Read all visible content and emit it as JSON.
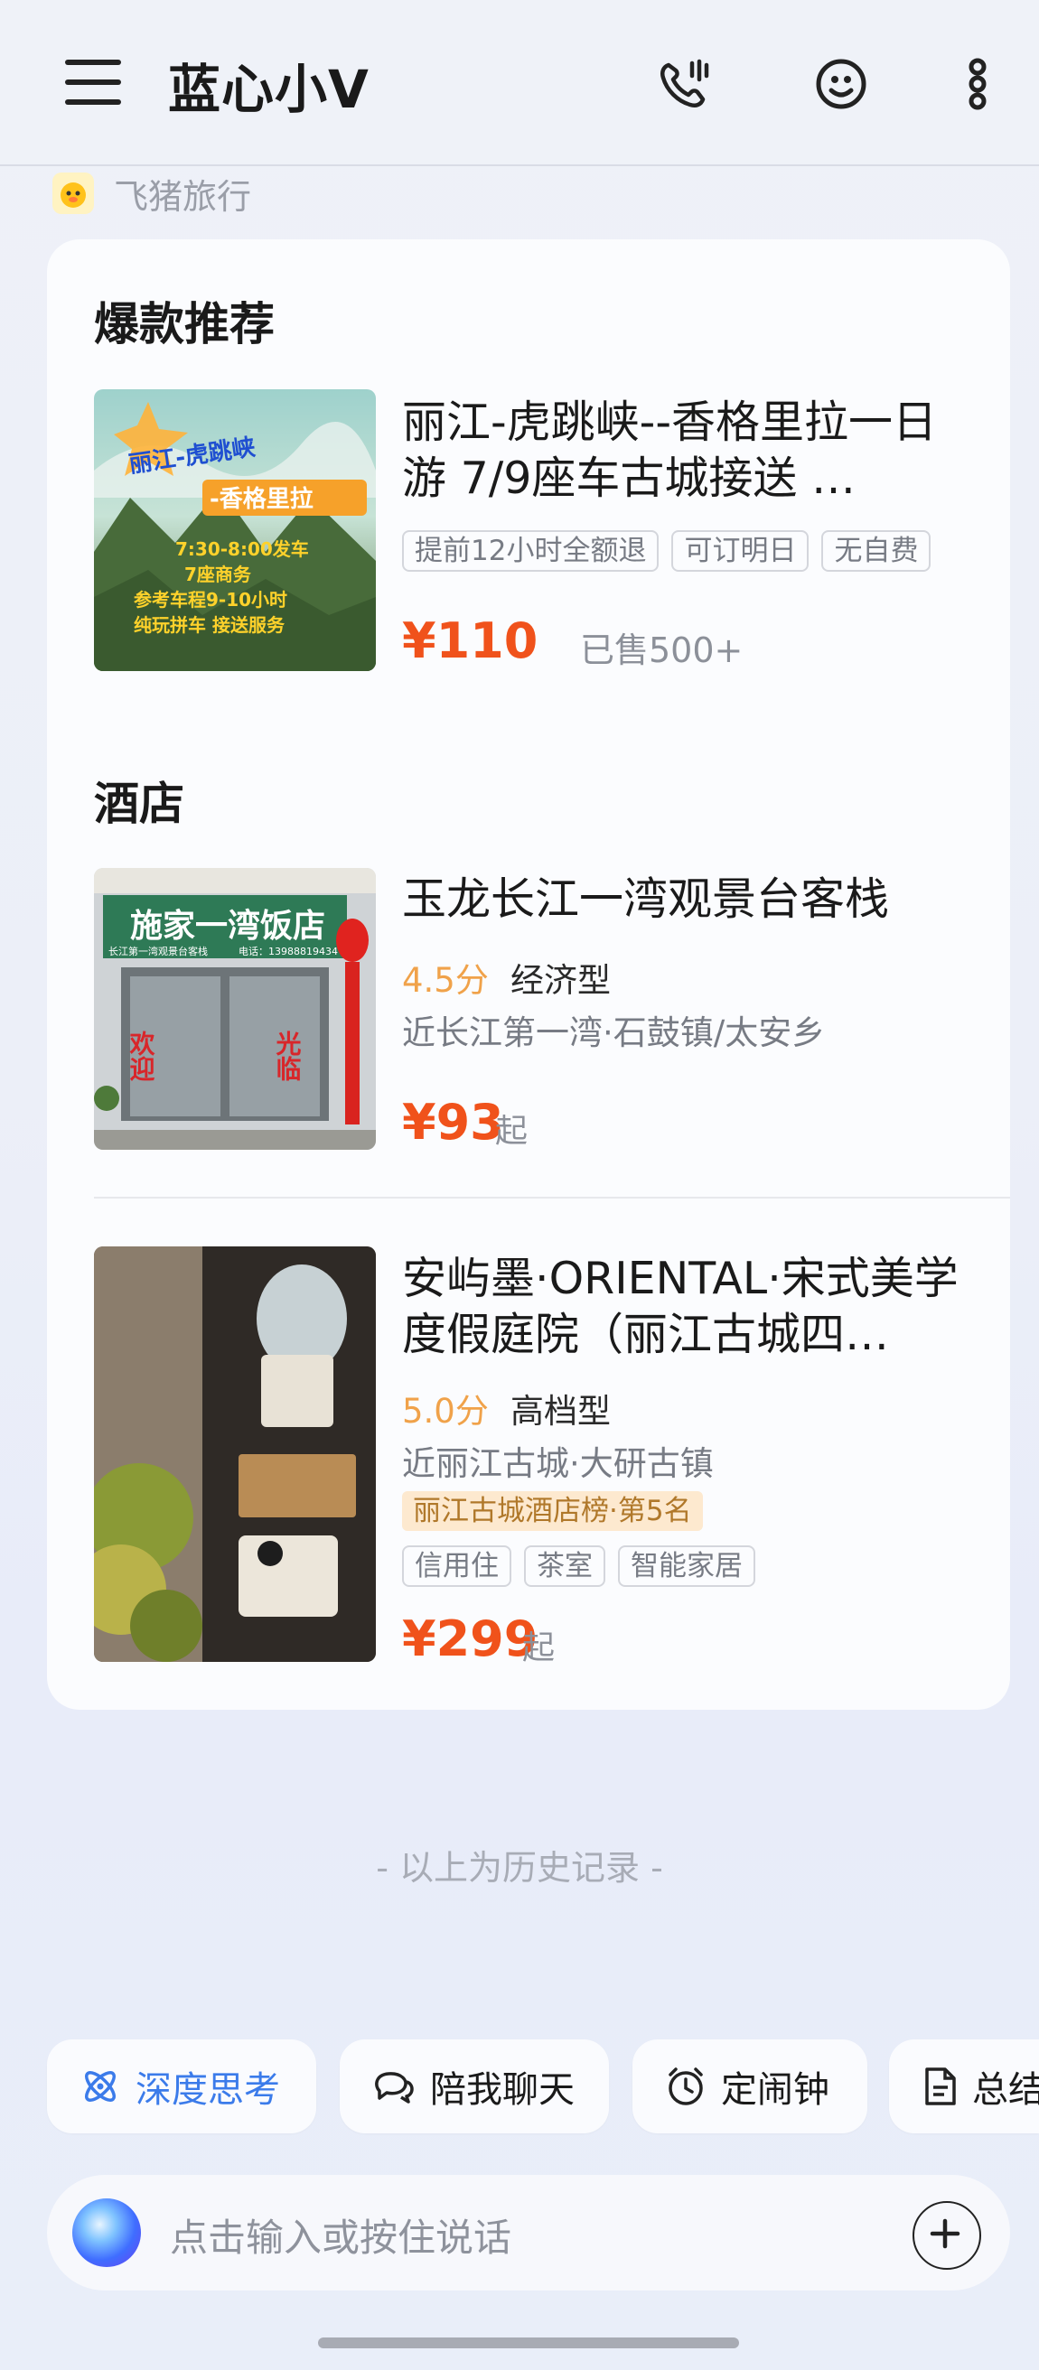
{
  "header": {
    "title": "蓝心小V",
    "icons": [
      "menu-icon",
      "phone-call-icon",
      "emoji-icon",
      "more-vertical-icon"
    ]
  },
  "source": {
    "name": "飞猪旅行",
    "icon": "fliggy-logo"
  },
  "sections": {
    "hot": {
      "title": "爆款推荐",
      "item": {
        "title": "丽江-虎跳峡--香格里拉一日游 7/9座车古城接送 …",
        "tags": [
          "提前12小时全额退",
          "可订明日",
          "无自费"
        ],
        "price": "¥110",
        "sold": "已售500+",
        "image_text": {
          "line1": "丽江-虎跳峡",
          "line2": "-香格里拉",
          "line3": "7:30-8:00发车",
          "line4": "7座商务",
          "line5": "参考车程9-10小时",
          "line6": "纯玩拼车 接送服务"
        }
      }
    },
    "hotel": {
      "title": "酒店",
      "items": [
        {
          "title": "玉龙长江一湾观景台客栈",
          "score": "4.5分",
          "level": "经济型",
          "location": "近长江第一湾·石鼓镇/太安乡",
          "price": "¥93",
          "price_suffix": "起",
          "image_text": {
            "sign": "施家一湾饭店",
            "sub": "长江第一湾观景台客栈",
            "phone": "电话：13988819434",
            "left": "欢迎",
            "right": "光临"
          }
        },
        {
          "title": "安屿墨·ORIENTAL·宋式美学度假庭院（丽江古城四…",
          "score": "5.0分",
          "level": "高档型",
          "location": "近丽江古城·大研古镇",
          "rank": "丽江古城酒店榜·第5名",
          "tags": [
            "信用住",
            "茶室",
            "智能家居"
          ],
          "price": "¥299",
          "price_suffix": "起"
        }
      ]
    }
  },
  "history_text": "- 以上为历史记录 -",
  "chips": [
    {
      "label": "深度思考",
      "icon": "atom-icon"
    },
    {
      "label": "陪我聊天",
      "icon": "chat-bubbles-icon"
    },
    {
      "label": "定闹钟",
      "icon": "alarm-clock-icon"
    },
    {
      "label": "总结",
      "icon": "document-icon"
    }
  ],
  "input": {
    "placeholder": "点击输入或按住说话"
  },
  "colors": {
    "price": "#f0521b",
    "score": "#f0a24a",
    "accent": "#3b7bea",
    "rank_bg": "#fde9cf"
  }
}
